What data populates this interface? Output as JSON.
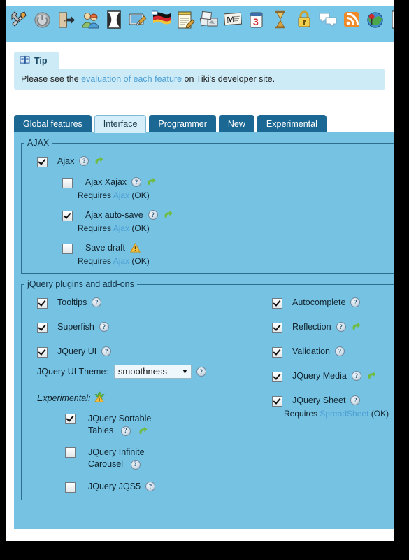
{
  "toolbar": {
    "icons": [
      {
        "name": "tools-icon",
        "glyph": "⚒"
      },
      {
        "name": "power-icon",
        "glyph": "⏻"
      },
      {
        "name": "logout-door-icon",
        "glyph": "⇤"
      },
      {
        "name": "users-group-icon",
        "glyph": "👥"
      },
      {
        "name": "hourglass-shape-icon",
        "glyph": "⧗"
      },
      {
        "name": "theme-paint-icon",
        "glyph": "🖼"
      },
      {
        "name": "german-flag-language-icon",
        "glyph": "⚑"
      },
      {
        "name": "notepad-edit-icon",
        "glyph": "📝"
      },
      {
        "name": "photo-gallery-icon",
        "glyph": "🖼"
      },
      {
        "name": "mail-card-icon",
        "glyph": "✉"
      },
      {
        "name": "calendar-day-3-icon",
        "glyph": "3"
      },
      {
        "name": "hourglass-icon",
        "glyph": "⌛"
      },
      {
        "name": "padlock-icon",
        "glyph": "🔒"
      },
      {
        "name": "chat-bubbles-icon",
        "glyph": "💬"
      },
      {
        "name": "rss-feed-icon",
        "glyph": "◴"
      },
      {
        "name": "globe-pin-icon",
        "glyph": "🌍"
      },
      {
        "name": "newspaper-article-icon",
        "glyph": "📰"
      },
      {
        "name": "file-box-icon",
        "glyph": "🗃"
      }
    ]
  },
  "tip": {
    "icon": "book-icon",
    "title": "Tip",
    "text_before": "Please see the ",
    "link": "evaluation of each feature",
    "text_after": " on Tiki's developer site."
  },
  "tabs": [
    {
      "label": "Global features",
      "active": false
    },
    {
      "label": "Interface",
      "active": true
    },
    {
      "label": "Programmer",
      "active": false
    },
    {
      "label": "New",
      "active": false
    },
    {
      "label": "Experimental",
      "active": false
    }
  ],
  "ajax": {
    "legend": "AJAX",
    "items": [
      {
        "label": "Ajax",
        "checked": true,
        "help": true,
        "arrow": true,
        "warn": false,
        "requires": null
      },
      {
        "label": "Ajax Xajax",
        "checked": false,
        "help": true,
        "arrow": true,
        "warn": false,
        "requires": {
          "prefix": "Requires ",
          "link": "Ajax",
          "suffix": " (OK)"
        }
      },
      {
        "label": "Ajax auto-save",
        "checked": true,
        "help": true,
        "arrow": true,
        "warn": false,
        "requires": {
          "prefix": "Requires ",
          "link": "Ajax",
          "suffix": " (OK)"
        }
      },
      {
        "label": "Save draft",
        "checked": false,
        "help": false,
        "arrow": false,
        "warn": true,
        "requires": {
          "prefix": "Requires ",
          "link": "Ajax",
          "suffix": " (OK)"
        }
      }
    ]
  },
  "jquery": {
    "legend": "jQuery plugins and add-ons",
    "left_items": [
      {
        "label": "Tooltips",
        "checked": true,
        "help": true,
        "arrow": false
      },
      {
        "label": "Superfish",
        "checked": true,
        "help": true,
        "arrow": false
      },
      {
        "label": "JQuery UI",
        "checked": true,
        "help": true,
        "arrow": false
      }
    ],
    "theme": {
      "label": "JQuery UI Theme:",
      "value": "smoothness",
      "caret": "▼",
      "options": [
        "smoothness"
      ]
    },
    "right_items": [
      {
        "label": "Autocomplete",
        "checked": true,
        "help": true,
        "arrow": false,
        "requires": null
      },
      {
        "label": "Reflection",
        "checked": true,
        "help": true,
        "arrow": true,
        "requires": null
      },
      {
        "label": "Validation",
        "checked": true,
        "help": true,
        "arrow": false,
        "requires": null
      },
      {
        "label": "JQuery Media",
        "checked": true,
        "help": true,
        "arrow": true,
        "requires": null
      },
      {
        "label": "JQuery Sheet",
        "checked": true,
        "help": true,
        "arrow": false,
        "requires": {
          "prefix": "Requires ",
          "link": "SpreadSheet",
          "suffix": " (OK)"
        }
      }
    ],
    "experimental": {
      "label": "Experimental:",
      "icon": "experimental-warning-icon",
      "items": [
        {
          "label_line1": "JQuery Sortable",
          "label_line2": "Tables",
          "checked": true,
          "help": true,
          "arrow": true
        },
        {
          "label_line1": "JQuery Infinite",
          "label_line2": "Carousel",
          "checked": false,
          "help": true,
          "arrow": false
        },
        {
          "label_line1": "JQuery JQS5",
          "label_line2": "",
          "checked": false,
          "help": true,
          "arrow": false
        }
      ]
    }
  },
  "colors": {
    "toolbar_bg": "#79c7e8",
    "panel_bg": "#76c2e3",
    "tab_bg": "#1c6894",
    "tab_active_bg": "#d6eefa",
    "tip_bg": "#cdebf7",
    "link": "#4b9fd5",
    "arrow_green": "#6fbb3e",
    "warn_yellow": "#f5c243"
  }
}
